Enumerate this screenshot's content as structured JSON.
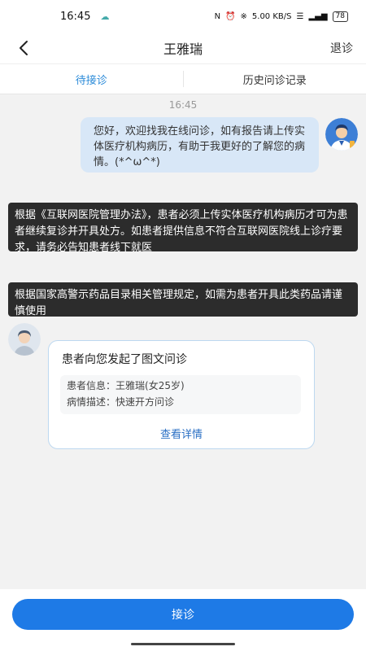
{
  "status_bar": {
    "time": "16:45",
    "network_speed": "5.00 KB/S",
    "battery": "78"
  },
  "nav": {
    "title": "王雅瑞",
    "action": "退诊"
  },
  "tabs": [
    {
      "label": "待接诊",
      "active": true
    },
    {
      "label": "历史问诊记录",
      "active": false
    }
  ],
  "chat": {
    "timestamp": "16:45",
    "doctor_message": "您好，欢迎找我在线问诊，如有报告请上传实体医疗机构病历，有助于我更好的了解您的病情。(*^ω^*)",
    "notices": [
      "根据《互联网医院管理办法》，患者必须上传实体医疗机构病历才可为患者继续复诊并开具处方。如患者提供信息不符合互联网医院线上诊疗要求，请务必告知患者线下就医",
      "根据国家高警示药品目录相关管理规定，如需为患者开具此类药品请谨慎使用"
    ],
    "consult_card": {
      "title": "患者向您发起了图文问诊",
      "patient_info_label": "患者信息：",
      "patient_info_value": "王雅瑞(女25岁)",
      "description_label": "病情描述：",
      "description_value": "快速开方问诊",
      "link": "查看详情"
    }
  },
  "bottom": {
    "accept_label": "接诊"
  },
  "colors": {
    "accent": "#1e7ae6",
    "tab_active": "#2a8ad8",
    "bubble": "#d8e7f7",
    "notice_bg": "#2c2c2c"
  }
}
